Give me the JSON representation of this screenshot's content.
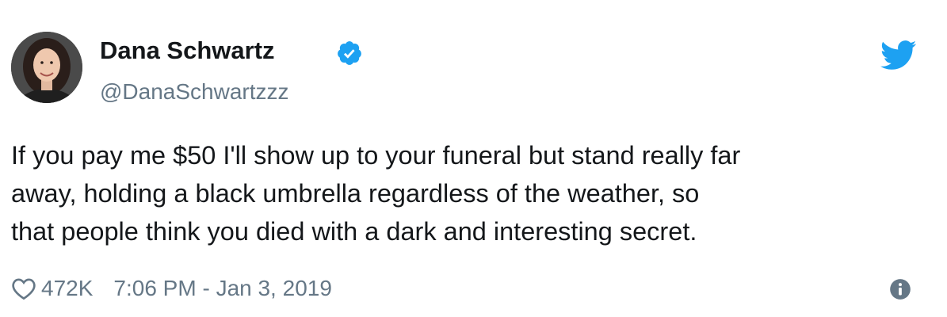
{
  "author": {
    "name": "Dana Schwartz",
    "handle": "@DanaSchwartzzz",
    "verified": true,
    "avatar_icon": "profile-photo"
  },
  "tweet": {
    "text_lines": [
      "If you pay me $50 I'll show up to your funeral but stand really far",
      "away, holding a black umbrella regardless of the weather, so",
      "that people think you died with a dark and interesting secret."
    ]
  },
  "footer": {
    "likes": "472K",
    "timestamp": "7:06 PM - Jan 3, 2019",
    "icons": [
      "heart-icon",
      "info-icon"
    ]
  },
  "brand": {
    "icon": "twitter-bird-icon",
    "accent_color": "#1da1f2",
    "muted_text_color": "#657786",
    "text_color": "#14171a"
  }
}
